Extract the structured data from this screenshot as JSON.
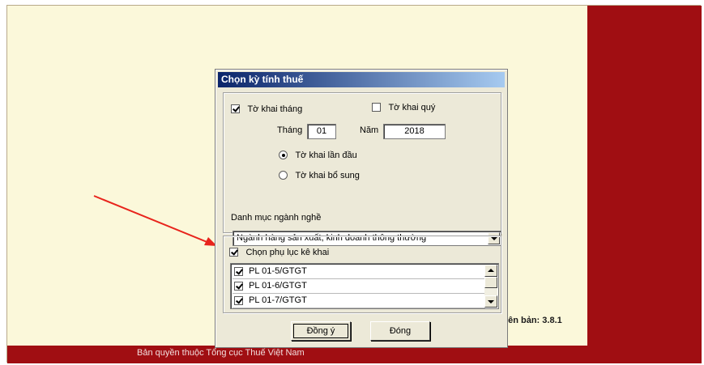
{
  "footer": {
    "copyright": "Bản quyền thuộc Tổng cục Thuế Việt Nam"
  },
  "app": {
    "version_text": "iiên bản: 3.8.1"
  },
  "dialog": {
    "title": "Chọn kỳ tính thuế",
    "monthly_label": "Tờ khai tháng",
    "monthly_checked": true,
    "quarterly_label": "Tờ khai quý",
    "quarterly_checked": false,
    "month_label": "Tháng",
    "month_value": "01",
    "year_label": "Năm",
    "year_value": "2018",
    "first_time_label": "Tờ khai lần đầu",
    "supplement_label": "Tờ khai bổ sung",
    "selected_declaration": "first_time",
    "industry_label": "Danh mục ngành nghề",
    "industry_value": "Ngành hàng sản xuất, kinh doanh thông thường",
    "appendix_label": "Chọn phụ lục kê khai",
    "appendix_checked": true,
    "appendices": [
      {
        "label": "PL 01-5/GTGT",
        "checked": true
      },
      {
        "label": "PL 01-6/GTGT",
        "checked": true
      },
      {
        "label": "PL 01-7/GTGT",
        "checked": true
      }
    ],
    "ok_label": "Đồng ý",
    "close_label": "Đóng"
  },
  "colors": {
    "background": "#fbf8da",
    "brand_red": "#a00e12",
    "dialog_face": "#ece9d8",
    "titlebar_start": "#0a246a",
    "titlebar_end": "#a6caf0",
    "annotation_arrow": "#e8241c"
  }
}
